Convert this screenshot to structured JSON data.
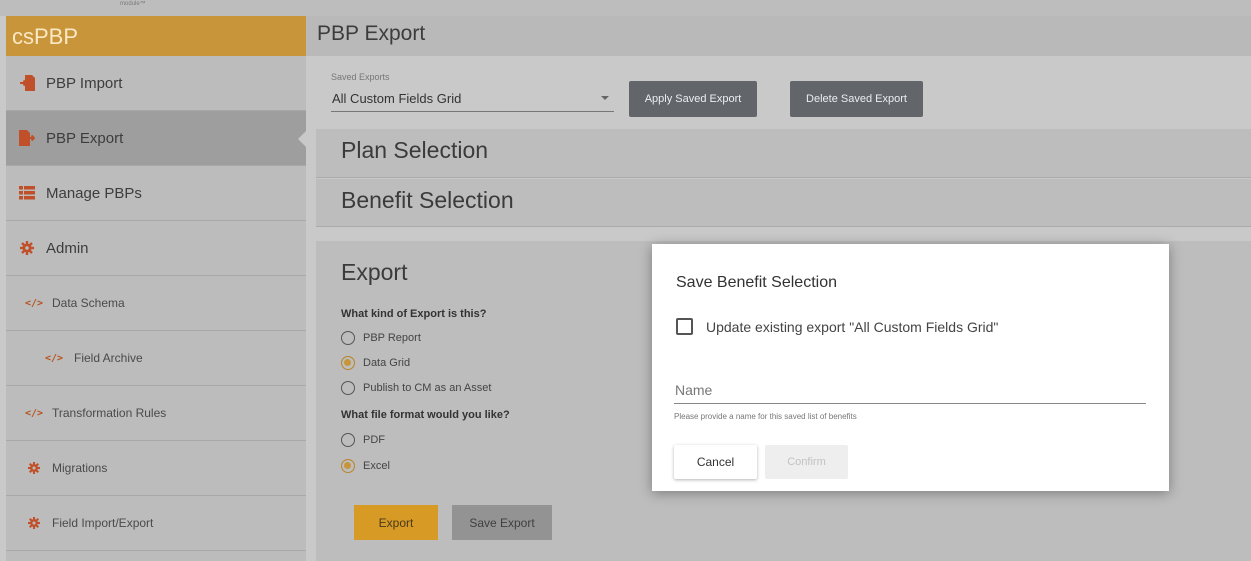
{
  "top_strip": {
    "tiny_text": "module™"
  },
  "sidebar": {
    "brand": "csPBP",
    "items": [
      {
        "label": "PBP Import",
        "icon": "import-icon"
      },
      {
        "label": "PBP Export",
        "icon": "export-icon",
        "active": true
      },
      {
        "label": "Manage PBPs",
        "icon": "list-icon"
      },
      {
        "label": "Admin",
        "icon": "gear-icon"
      },
      {
        "label": "Data Schema",
        "icon": "code-icon"
      },
      {
        "label": "Field Archive",
        "icon": "code-icon"
      },
      {
        "label": "Transformation Rules",
        "icon": "code-icon"
      },
      {
        "label": "Migrations",
        "icon": "gear-icon"
      },
      {
        "label": "Field Import/Export",
        "icon": "gear-icon"
      }
    ]
  },
  "header": {
    "title": "PBP Export"
  },
  "saved_exports": {
    "label": "Saved Exports",
    "selected": "All Custom Fields Grid",
    "apply_label": "Apply Saved Export",
    "delete_label": "Delete Saved Export"
  },
  "panels": {
    "plan_selection": "Plan Selection",
    "benefit_selection": "Benefit Selection"
  },
  "export": {
    "title": "Export",
    "kind_question": "What kind of Export is this?",
    "kind_options": [
      "PBP Report",
      "Data Grid",
      "Publish to CM as an Asset"
    ],
    "kind_selected": "Data Grid",
    "format_question": "What file format would you like?",
    "format_options": [
      "PDF",
      "Excel"
    ],
    "format_selected": "Excel",
    "export_label": "Export",
    "save_export_label": "Save Export"
  },
  "dialog": {
    "title": "Save Benefit Selection",
    "checkbox_label": "Update existing export \"All Custom Fields Grid\"",
    "checkbox_checked": false,
    "name_placeholder": "Name",
    "name_value": "",
    "hint": "Please provide a name for this saved list of benefits",
    "cancel_label": "Cancel",
    "confirm_label": "Confirm"
  },
  "colors": {
    "accent": "#c8953a",
    "export_button": "#d79a25",
    "dark_button": "#62666a"
  }
}
